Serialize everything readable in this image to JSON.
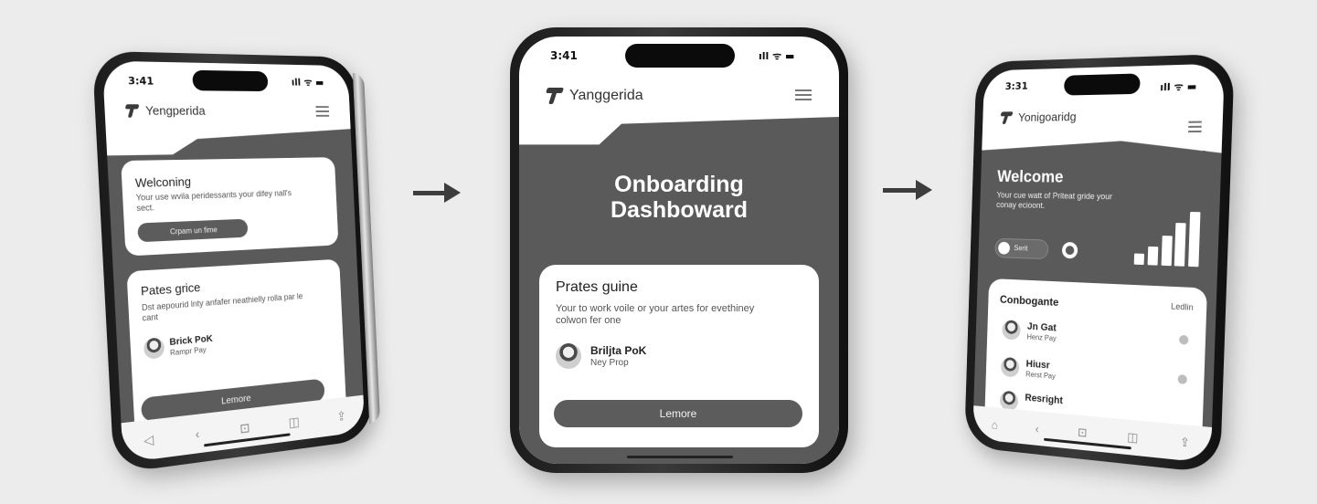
{
  "phone_left": {
    "time": "3:41",
    "signal": "ıll ᯤ ▬",
    "brand": "Yengperida",
    "welcome_card": {
      "title": "Welconing",
      "body": "Your use wvila peridessants your difey nall's sect.",
      "button": "Crpam un fime"
    },
    "guide_card": {
      "title": "Pates grice",
      "body": "Dst aepourid lnty anfafer neathielly rolla par le cant",
      "person_name": "Brick PoK",
      "person_role": "Rampr Pay",
      "button": "Lemore"
    },
    "nav_icons": [
      "◁",
      "‹",
      "⊡",
      "◫",
      "⇪"
    ]
  },
  "phone_center": {
    "time": "3:41",
    "signal": "ıll ᯤ ▬",
    "brand": "Yanggerida",
    "hero_title_line1": "Onboarding",
    "hero_title_line2": "Dashboward",
    "card": {
      "title": "Prates guine",
      "body": "Your to work voile or your artes for evethiney colwon fer one",
      "person_name": "Briljta PoK",
      "person_role": "Ney Prop",
      "button": "Lemore"
    }
  },
  "phone_right": {
    "time": "3:31",
    "signal": "ıll ᯤ ▬",
    "brand": "Yonigoaridg",
    "welcome_title": "Welcome",
    "welcome_body": "Your cue watt of Priteat gride your conay ecioont.",
    "toggle_label": "Serit",
    "bar_levels": [
      0.2,
      0.35,
      0.55,
      0.8,
      1.0
    ],
    "list_title": "Conbogante",
    "list_action": "Ledlin",
    "people": [
      {
        "name": "Jn Gat",
        "role": "Henz Pay"
      },
      {
        "name": "Hiusr",
        "role": "Rerst Pay"
      },
      {
        "name": "Resright",
        "role": ""
      }
    ],
    "nav_icons": [
      "⌂",
      "‹",
      "⊡",
      "◫",
      "⇪"
    ]
  },
  "colors": {
    "background": "#ececec",
    "panel_grey": "#5a5a5a",
    "button_grey": "#5c5c5c",
    "card_white": "#ffffff"
  }
}
